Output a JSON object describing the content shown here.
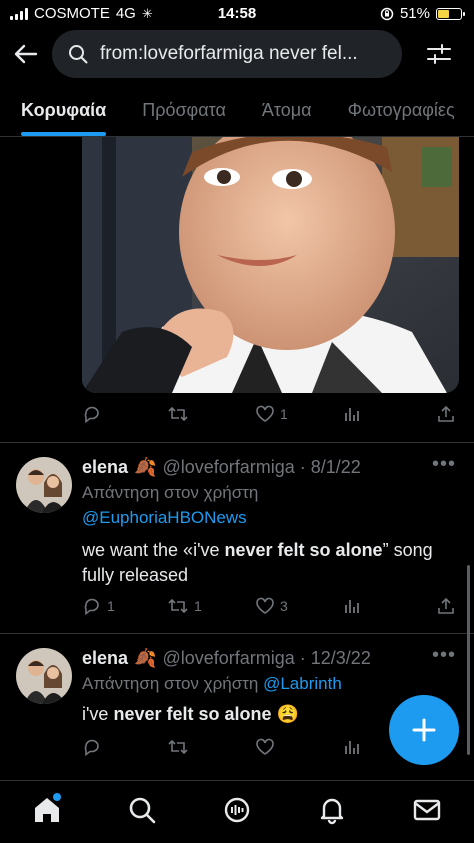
{
  "status_bar": {
    "carrier": "COSMOTE",
    "network": "4G",
    "time": "14:58",
    "battery": "51%",
    "battery_level": 0.51
  },
  "search": {
    "query": "from:loveforfarmiga never fel...",
    "icon": "search-icon"
  },
  "tabs": [
    {
      "label": "Κορυφαία",
      "active": true
    },
    {
      "label": "Πρόσφατα",
      "active": false
    },
    {
      "label": "Άτομα",
      "active": false
    },
    {
      "label": "Φωτογραφίες",
      "active": false
    }
  ],
  "tweets": [
    {
      "replies": "",
      "retweets": "",
      "likes": "1"
    },
    {
      "name": "elena",
      "emoji": "🍂",
      "handle": "@loveforfarmiga · 8/1/22",
      "reply_prefix": "Απάντηση στον χρήστη",
      "reply_to": "@EuphoriaHBONews",
      "text_before": "we want the «i've ",
      "text_bold": "never felt so alone",
      "text_after": "” song fully released",
      "replies": "1",
      "retweets": "1",
      "likes": "3"
    },
    {
      "name": "elena",
      "emoji": "🍂",
      "handle": "@loveforfarmiga · 12/3/22",
      "reply_prefix": "Απάντηση στον χρήστη",
      "reply_to": "@Labrinth",
      "text_before": "i've ",
      "text_bold": "never felt so alone",
      "text_after": " 😩",
      "replies": "",
      "retweets": "",
      "likes": ""
    }
  ],
  "colors": {
    "background": "#000000",
    "accent": "#1d9bf0",
    "muted": "#71767b",
    "text": "#e7e9ea"
  },
  "nav_icons": [
    "home-icon",
    "search-icon",
    "spaces-icon",
    "notifications-icon",
    "messages-icon"
  ]
}
